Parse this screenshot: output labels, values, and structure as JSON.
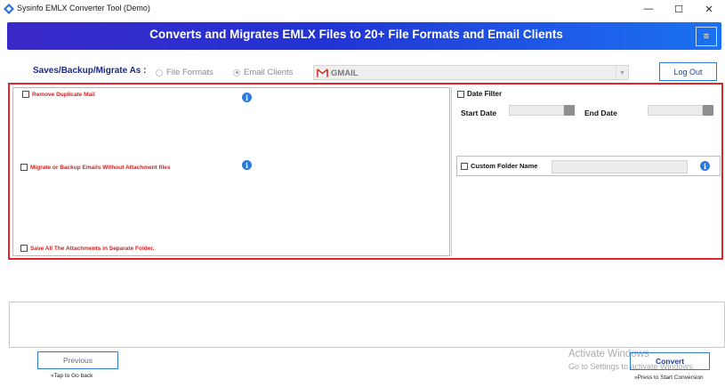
{
  "window": {
    "title": "Sysinfo EMLX Converter Tool (Demo)",
    "minimize": "—",
    "maximize": "☐",
    "close": "✕"
  },
  "banner": {
    "title": "Converts and Migrates EMLX Files to 20+ File Formats and Email Clients",
    "menu_glyph": "≡"
  },
  "saves": {
    "label": "Saves/Backup/Migrate As :",
    "option_file_formats": "File Formats",
    "option_email_clients": "Email Clients",
    "selected_option": "Email Clients",
    "dropdown_value": "GMAIL",
    "chevron": "▾"
  },
  "logout_label": "Log Out",
  "options": {
    "remove_duplicate": "Remove Duplicate Mail",
    "without_attachment": "Migrate or Backup Emails Without Attachment files",
    "save_attachments": "Save All The Attachments in Separate Folder.",
    "info_glyph": "i"
  },
  "date_filter": {
    "label": "Date Filter",
    "start_label": "Start Date",
    "end_label": "End Date"
  },
  "custom_folder": {
    "label": "Custom Folder Name",
    "value": ""
  },
  "navigation": {
    "previous_label": "Previous",
    "previous_hint": "»Tap to Go back",
    "convert_label": "Convert",
    "convert_hint": "»Press to Start Conversion"
  },
  "watermark": {
    "line1": "Activate Windows",
    "line2": "Go to Settings to activate Windows."
  },
  "colors": {
    "banner_start": "#3b28c8",
    "banner_end": "#1b72f0",
    "highlight_frame": "#e0272f",
    "option_text": "#d42020",
    "button_border": "#2b79d8",
    "info_icon": "#2a7ae2"
  }
}
